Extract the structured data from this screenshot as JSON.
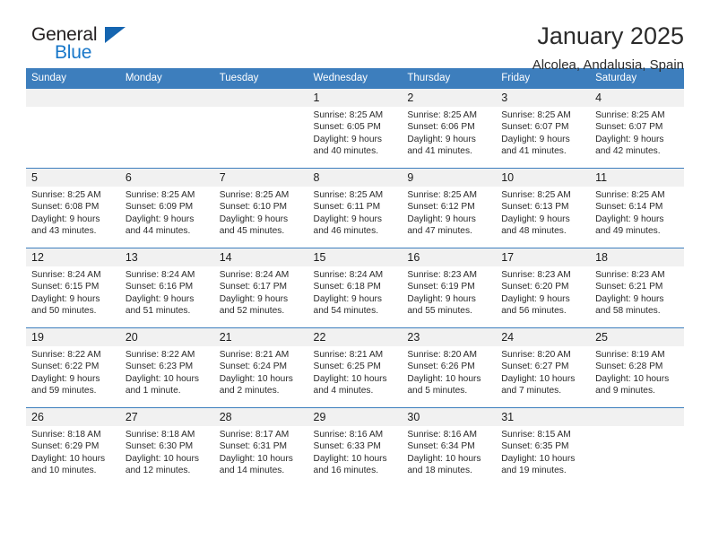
{
  "brand": {
    "name_top": "General",
    "name_bottom": "Blue",
    "logo_icon": "triangle-icon",
    "accent_color": "#1877c9"
  },
  "header": {
    "month_title": "January 2025",
    "location": "Alcolea, Andalusia, Spain"
  },
  "calendar": {
    "header_color": "#3d7ebd",
    "daynum_bg": "#f1f1f1",
    "weekdays": [
      "Sunday",
      "Monday",
      "Tuesday",
      "Wednesday",
      "Thursday",
      "Friday",
      "Saturday"
    ],
    "weeks": [
      [
        {
          "day": "",
          "empty": true
        },
        {
          "day": "",
          "empty": true
        },
        {
          "day": "",
          "empty": true
        },
        {
          "day": "1",
          "sunrise": "Sunrise: 8:25 AM",
          "sunset": "Sunset: 6:05 PM",
          "daylight_line1": "Daylight: 9 hours",
          "daylight_line2": "and 40 minutes."
        },
        {
          "day": "2",
          "sunrise": "Sunrise: 8:25 AM",
          "sunset": "Sunset: 6:06 PM",
          "daylight_line1": "Daylight: 9 hours",
          "daylight_line2": "and 41 minutes."
        },
        {
          "day": "3",
          "sunrise": "Sunrise: 8:25 AM",
          "sunset": "Sunset: 6:07 PM",
          "daylight_line1": "Daylight: 9 hours",
          "daylight_line2": "and 41 minutes."
        },
        {
          "day": "4",
          "sunrise": "Sunrise: 8:25 AM",
          "sunset": "Sunset: 6:07 PM",
          "daylight_line1": "Daylight: 9 hours",
          "daylight_line2": "and 42 minutes."
        }
      ],
      [
        {
          "day": "5",
          "sunrise": "Sunrise: 8:25 AM",
          "sunset": "Sunset: 6:08 PM",
          "daylight_line1": "Daylight: 9 hours",
          "daylight_line2": "and 43 minutes."
        },
        {
          "day": "6",
          "sunrise": "Sunrise: 8:25 AM",
          "sunset": "Sunset: 6:09 PM",
          "daylight_line1": "Daylight: 9 hours",
          "daylight_line2": "and 44 minutes."
        },
        {
          "day": "7",
          "sunrise": "Sunrise: 8:25 AM",
          "sunset": "Sunset: 6:10 PM",
          "daylight_line1": "Daylight: 9 hours",
          "daylight_line2": "and 45 minutes."
        },
        {
          "day": "8",
          "sunrise": "Sunrise: 8:25 AM",
          "sunset": "Sunset: 6:11 PM",
          "daylight_line1": "Daylight: 9 hours",
          "daylight_line2": "and 46 minutes."
        },
        {
          "day": "9",
          "sunrise": "Sunrise: 8:25 AM",
          "sunset": "Sunset: 6:12 PM",
          "daylight_line1": "Daylight: 9 hours",
          "daylight_line2": "and 47 minutes."
        },
        {
          "day": "10",
          "sunrise": "Sunrise: 8:25 AM",
          "sunset": "Sunset: 6:13 PM",
          "daylight_line1": "Daylight: 9 hours",
          "daylight_line2": "and 48 minutes."
        },
        {
          "day": "11",
          "sunrise": "Sunrise: 8:25 AM",
          "sunset": "Sunset: 6:14 PM",
          "daylight_line1": "Daylight: 9 hours",
          "daylight_line2": "and 49 minutes."
        }
      ],
      [
        {
          "day": "12",
          "sunrise": "Sunrise: 8:24 AM",
          "sunset": "Sunset: 6:15 PM",
          "daylight_line1": "Daylight: 9 hours",
          "daylight_line2": "and 50 minutes."
        },
        {
          "day": "13",
          "sunrise": "Sunrise: 8:24 AM",
          "sunset": "Sunset: 6:16 PM",
          "daylight_line1": "Daylight: 9 hours",
          "daylight_line2": "and 51 minutes."
        },
        {
          "day": "14",
          "sunrise": "Sunrise: 8:24 AM",
          "sunset": "Sunset: 6:17 PM",
          "daylight_line1": "Daylight: 9 hours",
          "daylight_line2": "and 52 minutes."
        },
        {
          "day": "15",
          "sunrise": "Sunrise: 8:24 AM",
          "sunset": "Sunset: 6:18 PM",
          "daylight_line1": "Daylight: 9 hours",
          "daylight_line2": "and 54 minutes."
        },
        {
          "day": "16",
          "sunrise": "Sunrise: 8:23 AM",
          "sunset": "Sunset: 6:19 PM",
          "daylight_line1": "Daylight: 9 hours",
          "daylight_line2": "and 55 minutes."
        },
        {
          "day": "17",
          "sunrise": "Sunrise: 8:23 AM",
          "sunset": "Sunset: 6:20 PM",
          "daylight_line1": "Daylight: 9 hours",
          "daylight_line2": "and 56 minutes."
        },
        {
          "day": "18",
          "sunrise": "Sunrise: 8:23 AM",
          "sunset": "Sunset: 6:21 PM",
          "daylight_line1": "Daylight: 9 hours",
          "daylight_line2": "and 58 minutes."
        }
      ],
      [
        {
          "day": "19",
          "sunrise": "Sunrise: 8:22 AM",
          "sunset": "Sunset: 6:22 PM",
          "daylight_line1": "Daylight: 9 hours",
          "daylight_line2": "and 59 minutes."
        },
        {
          "day": "20",
          "sunrise": "Sunrise: 8:22 AM",
          "sunset": "Sunset: 6:23 PM",
          "daylight_line1": "Daylight: 10 hours",
          "daylight_line2": "and 1 minute."
        },
        {
          "day": "21",
          "sunrise": "Sunrise: 8:21 AM",
          "sunset": "Sunset: 6:24 PM",
          "daylight_line1": "Daylight: 10 hours",
          "daylight_line2": "and 2 minutes."
        },
        {
          "day": "22",
          "sunrise": "Sunrise: 8:21 AM",
          "sunset": "Sunset: 6:25 PM",
          "daylight_line1": "Daylight: 10 hours",
          "daylight_line2": "and 4 minutes."
        },
        {
          "day": "23",
          "sunrise": "Sunrise: 8:20 AM",
          "sunset": "Sunset: 6:26 PM",
          "daylight_line1": "Daylight: 10 hours",
          "daylight_line2": "and 5 minutes."
        },
        {
          "day": "24",
          "sunrise": "Sunrise: 8:20 AM",
          "sunset": "Sunset: 6:27 PM",
          "daylight_line1": "Daylight: 10 hours",
          "daylight_line2": "and 7 minutes."
        },
        {
          "day": "25",
          "sunrise": "Sunrise: 8:19 AM",
          "sunset": "Sunset: 6:28 PM",
          "daylight_line1": "Daylight: 10 hours",
          "daylight_line2": "and 9 minutes."
        }
      ],
      [
        {
          "day": "26",
          "sunrise": "Sunrise: 8:18 AM",
          "sunset": "Sunset: 6:29 PM",
          "daylight_line1": "Daylight: 10 hours",
          "daylight_line2": "and 10 minutes."
        },
        {
          "day": "27",
          "sunrise": "Sunrise: 8:18 AM",
          "sunset": "Sunset: 6:30 PM",
          "daylight_line1": "Daylight: 10 hours",
          "daylight_line2": "and 12 minutes."
        },
        {
          "day": "28",
          "sunrise": "Sunrise: 8:17 AM",
          "sunset": "Sunset: 6:31 PM",
          "daylight_line1": "Daylight: 10 hours",
          "daylight_line2": "and 14 minutes."
        },
        {
          "day": "29",
          "sunrise": "Sunrise: 8:16 AM",
          "sunset": "Sunset: 6:33 PM",
          "daylight_line1": "Daylight: 10 hours",
          "daylight_line2": "and 16 minutes."
        },
        {
          "day": "30",
          "sunrise": "Sunrise: 8:16 AM",
          "sunset": "Sunset: 6:34 PM",
          "daylight_line1": "Daylight: 10 hours",
          "daylight_line2": "and 18 minutes."
        },
        {
          "day": "31",
          "sunrise": "Sunrise: 8:15 AM",
          "sunset": "Sunset: 6:35 PM",
          "daylight_line1": "Daylight: 10 hours",
          "daylight_line2": "and 19 minutes."
        },
        {
          "day": "",
          "empty": true
        }
      ]
    ]
  }
}
